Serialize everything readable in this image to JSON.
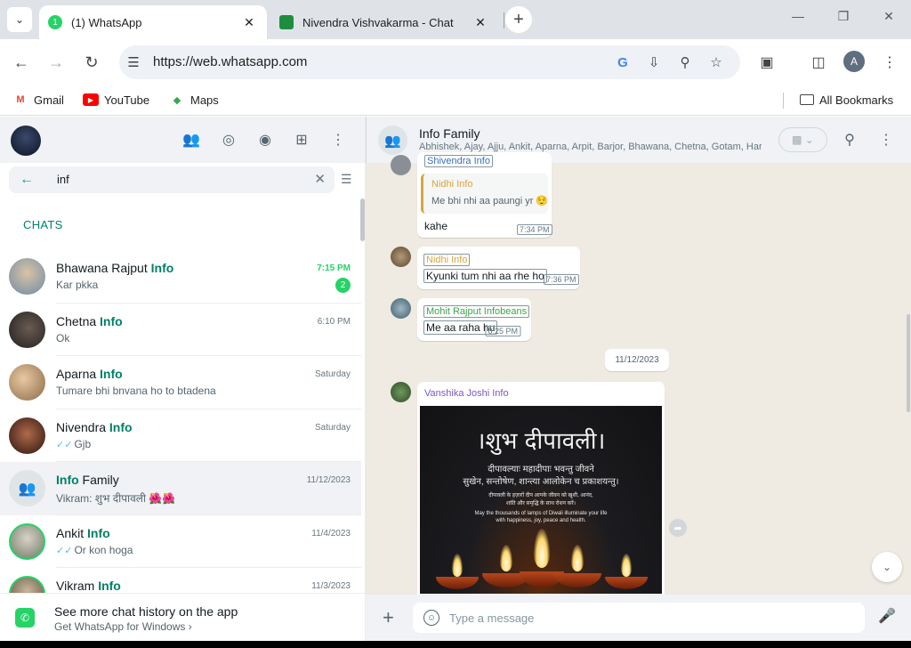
{
  "browser": {
    "tabs": [
      {
        "title": "(1) WhatsApp",
        "favicon": "whatsapp-favicon",
        "active": true
      },
      {
        "title": "Nivendra Vishvakarma - Chat",
        "favicon": "chat-favicon",
        "active": false
      }
    ],
    "url": "https://web.whatsapp.com",
    "bookmarks": [
      {
        "label": "Gmail",
        "icon": "gmail-icon"
      },
      {
        "label": "YouTube",
        "icon": "youtube-icon"
      },
      {
        "label": "Maps",
        "icon": "maps-icon"
      }
    ],
    "all_bookmarks": "All Bookmarks",
    "profile_initial": "A"
  },
  "sidebar": {
    "search_query": "inf",
    "section_title": "CHATS",
    "chats": [
      {
        "name_plain": "Bhawana Rajput ",
        "name_match": "Info",
        "time": "7:15 PM",
        "last": "Kar pkka",
        "unread": "2",
        "ticks": "",
        "avatar_color": "#a3b4c6"
      },
      {
        "name_plain": "Chetna ",
        "name_match": "Info",
        "time": "6:10 PM",
        "last": "Ok",
        "unread": "",
        "ticks": "",
        "avatar_color": "#3b3b3b"
      },
      {
        "name_plain": "Aparna ",
        "name_match": "Info",
        "time": "Saturday",
        "last": "Tumare bhi bnvana ho to btadena",
        "unread": "",
        "ticks": "",
        "avatar_color": "#b08c62"
      },
      {
        "name_plain": "Nivendra ",
        "name_match": "Info",
        "time": "Saturday",
        "last": "Gjb",
        "unread": "",
        "ticks": "✓✓",
        "avatar_color": "#4a2a22"
      },
      {
        "name_match_first": "Info",
        "name_plain_after": " Family",
        "time": "11/12/2023",
        "last": "Vikram: शुभ दीपावली 🌺🌺",
        "unread": "",
        "ticks": "",
        "avatar_color": "#dfe5e7"
      },
      {
        "name_plain": "Ankit ",
        "name_match": "Info",
        "time": "11/4/2023",
        "last": "Or kon hoga",
        "unread": "",
        "ticks": "✓✓",
        "avatar_color": "#6f7b68"
      },
      {
        "name_plain": "Vikram ",
        "name_match": "Info",
        "time": "11/3/2023",
        "last": "",
        "unread": "",
        "ticks": "",
        "avatar_color": "#8a7c6a"
      }
    ],
    "promo": {
      "title": "See more chat history on the app",
      "subtitle": "Get WhatsApp for Windows"
    }
  },
  "conversation": {
    "title": "Info Family",
    "members": "Abhishek, Ajay, Ajju, Ankit, Aparna, Arpit, Barjor, Bhawana, Chetna, Gotam, Harsh, ...",
    "messages": [
      {
        "sender": "Shivendra Info",
        "quote_sender": "Nidhi Info",
        "quote_text": "Me bhi nhi aa paungi yr 😌",
        "text": "kahe",
        "time": "7:34 PM"
      },
      {
        "sender": "Nidhi Info",
        "text": "Kyunki tum nhi aa rhe ho",
        "time": "7:36 PM"
      },
      {
        "sender": "Mohit Rajput Infobeans",
        "text": "Me aa raha hu",
        "time": "8:25 PM"
      }
    ],
    "date_chip": "11/12/2023",
    "image_message": {
      "sender": "Vanshika Joshi Info",
      "image_title": "।शुभ दीपावली।",
      "image_line1": "दीपावल्याः महादीपाः भवन्तु जीवने",
      "image_line2": "सुखेन, सन्तोषेण, शान्त्या आलोकेन च प्रकाशयन्तु।",
      "image_line3": "दीपावली के हज़ारों दीप आपके जीवन को खुशी, आनंद,",
      "image_line4": "शांति और समृद्धि के साथ रोशन करें।",
      "image_line5": "May the thousands of lamps of Diwali illuminate your life",
      "image_line6": "with happiness, joy, peace and health."
    },
    "composer_placeholder": "Type a message"
  },
  "colors": {
    "accent": "#00a884",
    "match_highlight": "#008069",
    "unread": "#25d366",
    "chat_bg": "#efeae2",
    "sender_nidhi": "#d9a53e",
    "sender_mohit": "#3aa54b",
    "sender_vanshika": "#7e57c2"
  }
}
